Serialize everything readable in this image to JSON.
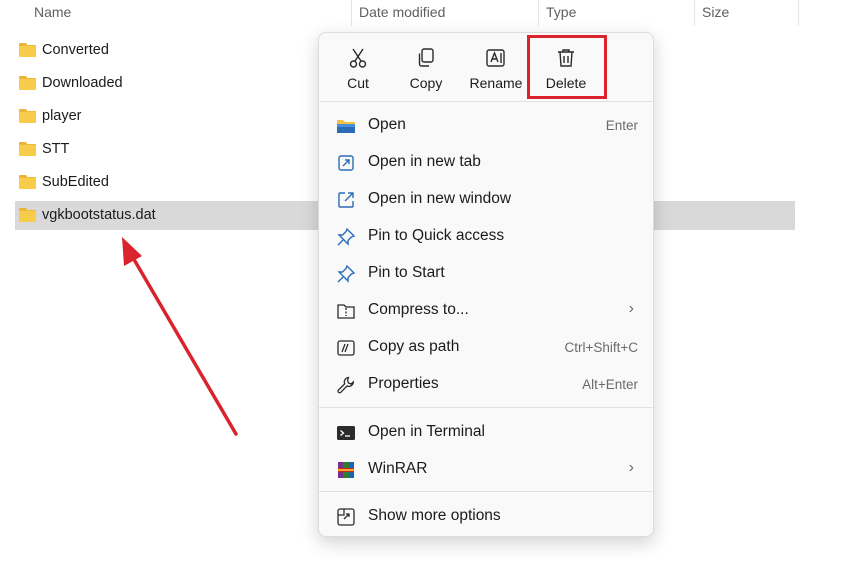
{
  "columns": {
    "name": "Name",
    "date_modified": "Date modified",
    "type": "Type",
    "size": "Size"
  },
  "files": [
    {
      "name": "Converted",
      "icon": "folder-icon"
    },
    {
      "name": "Downloaded",
      "icon": "folder-icon"
    },
    {
      "name": "player",
      "icon": "folder-icon"
    },
    {
      "name": "STT",
      "icon": "folder-icon"
    },
    {
      "name": "SubEdited",
      "icon": "folder-icon"
    },
    {
      "name": "vgkbootstatus.dat",
      "icon": "folder-icon",
      "selected": true
    }
  ],
  "context_menu": {
    "quick_actions": [
      {
        "label": "Cut",
        "icon": "scissors-icon"
      },
      {
        "label": "Copy",
        "icon": "copy-icon"
      },
      {
        "label": "Rename",
        "icon": "rename-icon"
      },
      {
        "label": "Delete",
        "icon": "trash-icon",
        "highlighted": true
      }
    ],
    "group1": [
      {
        "label": "Open",
        "shortcut": "Enter",
        "icon": "folder-open-icon"
      },
      {
        "label": "Open in new tab",
        "icon": "new-tab-icon"
      },
      {
        "label": "Open in new window",
        "icon": "new-window-icon"
      },
      {
        "label": "Pin to Quick access",
        "icon": "pin-icon"
      },
      {
        "label": "Pin to Start",
        "icon": "pin-icon"
      },
      {
        "label": "Compress to...",
        "icon": "compress-icon",
        "submenu": true
      },
      {
        "label": "Copy as path",
        "shortcut": "Ctrl+Shift+C",
        "icon": "copy-path-icon"
      },
      {
        "label": "Properties",
        "shortcut": "Alt+Enter",
        "icon": "wrench-icon"
      }
    ],
    "group2": [
      {
        "label": "Open in Terminal",
        "icon": "terminal-icon"
      },
      {
        "label": "WinRAR",
        "icon": "winrar-icon",
        "submenu": true
      }
    ],
    "group3": [
      {
        "label": "Show more options",
        "icon": "show-more-icon"
      }
    ],
    "submenu_glyph": "›"
  },
  "colors": {
    "highlight_box": "#d9232d",
    "arrow": "#d9232d",
    "folder": "#f8cc4b",
    "selected_row": "#d9d9d9",
    "icon_blue": "#2b6cb8"
  }
}
